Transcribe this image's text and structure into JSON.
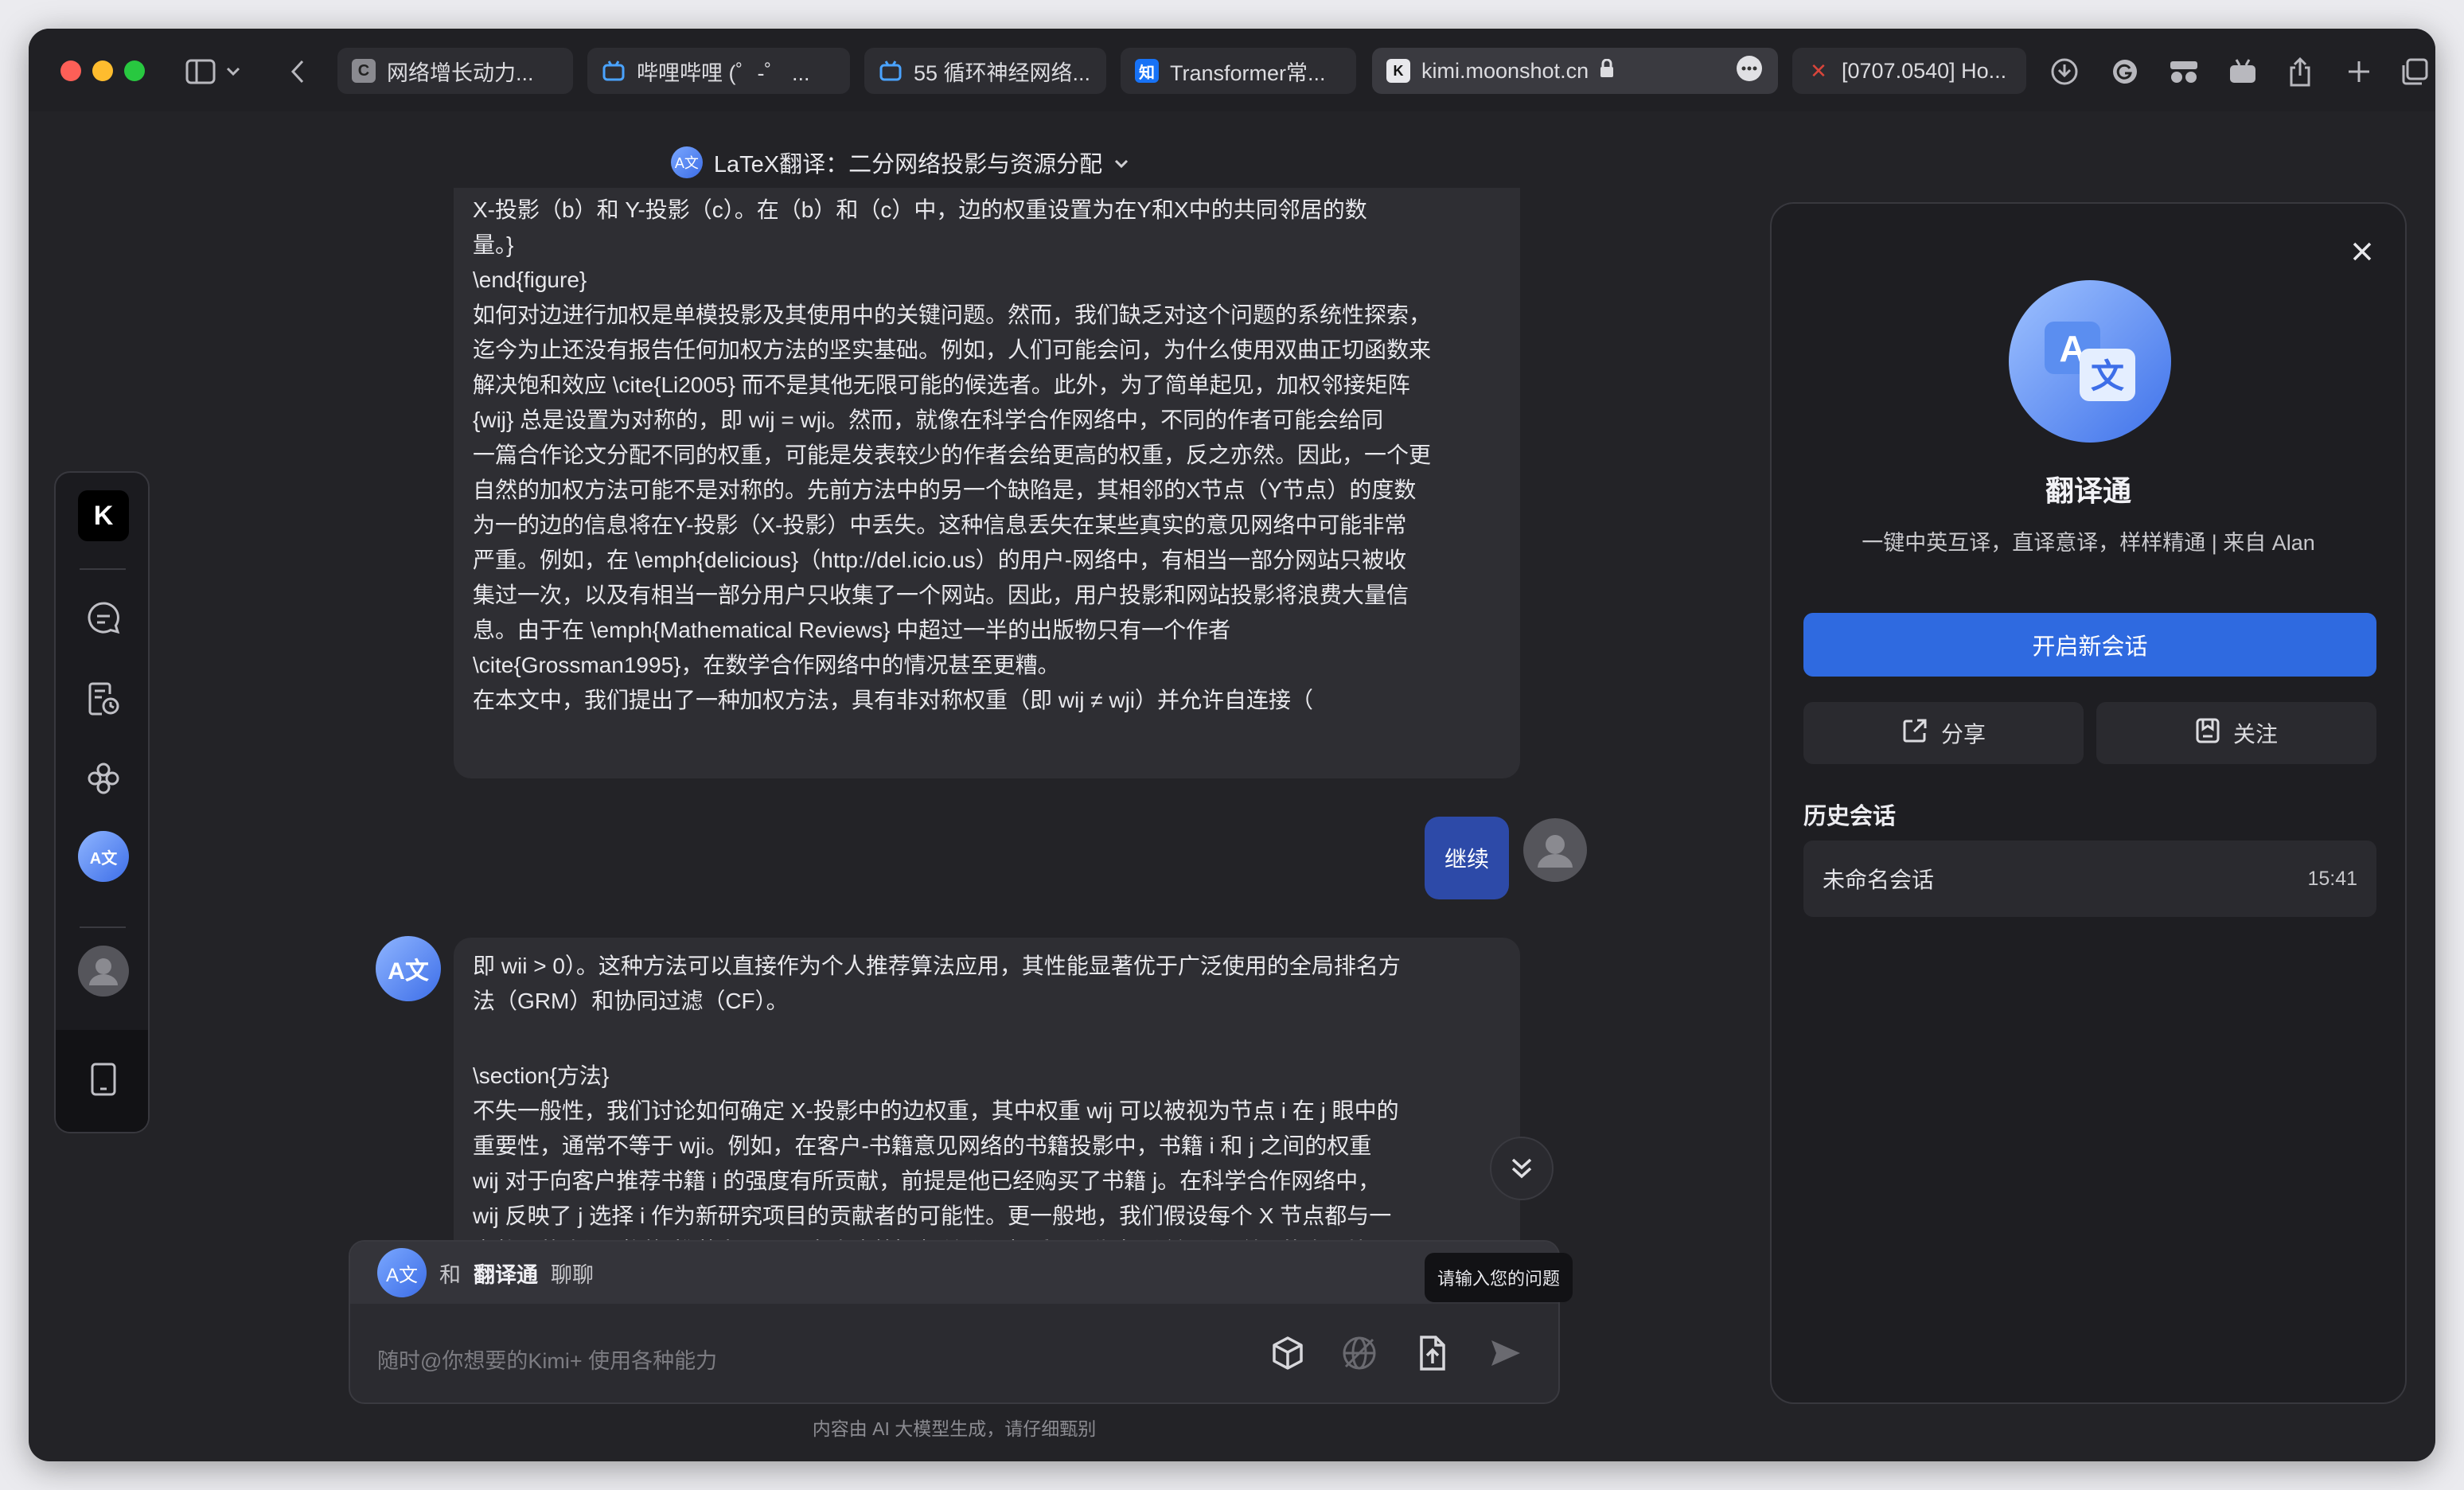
{
  "tabs": [
    {
      "favicon": "C",
      "label": "网络增长动力..."
    },
    {
      "favicon": "bilibili",
      "label": "哔哩哔哩 (゜-゜ ..."
    },
    {
      "favicon": "bilibili",
      "label": "55 循环神经网络..."
    },
    {
      "favicon": "知",
      "label": "Transformer常..."
    },
    {
      "favicon": "K",
      "label": "kimi.moonshot.cn"
    },
    {
      "favicon": "arxiv",
      "label": "[0707.0540] Ho..."
    }
  ],
  "header": {
    "title": "LaTeX翻译：二分网络投影与资源分配"
  },
  "messages": {
    "bot1": [
      "X-投影（b）和 Y-投影（c）。在（b）和（c）中，边的权重设置为在Y和X中的共同邻居的数",
      "量。}",
      "\\end{figure}",
      "如何对边进行加权是单模投影及其使用中的关键问题。然而，我们缺乏对这个问题的系统性探索，",
      "迄今为止还没有报告任何加权方法的坚实基础。例如，人们可能会问，为什么使用双曲正切函数来",
      "解决饱和效应 \\cite{Li2005} 而不是其他无限可能的候选者。此外，为了简单起见，加权邻接矩阵",
      "{wij} 总是设置为对称的，即 wij = wji。然而，就像在科学合作网络中，不同的作者可能会给同",
      "一篇合作论文分配不同的权重，可能是发表较少的作者会给更高的权重，反之亦然。因此，一个更",
      "自然的加权方法可能不是对称的。先前方法中的另一个缺陷是，其相邻的X节点（Y节点）的度数",
      "为一的边的信息将在Y-投影（X-投影）中丢失。这种信息丢失在某些真实的意见网络中可能非常",
      "严重。例如，在 \\emph{delicious}（http://del.icio.us）的用户-网络中，有相当一部分网站只被收",
      "集过一次，以及有相当一部分用户只收集了一个网站。因此，用户投影和网站投影将浪费大量信",
      "息。由于在 \\emph{Mathematical Reviews} 中超过一半的出版物只有一个作者",
      "\\cite{Grossman1995}，在数学合作网络中的情况甚至更糟。",
      "在本文中，我们提出了一种加权方法，具有非对称权重（即 wij ≠ wji）并允许自连接（"
    ],
    "user": "继续",
    "bot2": [
      "即 wii > 0）。这种方法可以直接作为个人推荐算法应用，其性能显著优于广泛使用的全局排名方",
      "法（GRM）和协同过滤（CF）。",
      "",
      "\\section{方法}",
      "不失一般性，我们讨论如何确定 X-投影中的边权重，其中权重 wij 可以被视为节点 i 在 j 眼中的",
      "重要性，通常不等于 wji。例如，在客户-书籍意见网络的书籍投影中，书籍 i 和 j 之间的权重",
      "wij 对于向客户推荐书籍 i 的强度有所贡献，前提是他已经购买了书籍 j。在科学合作网络中，",
      "wij 反映了 j 选择 i 作为新研究项目的贡献者的可能性。更一般地，我们假设每个 X 节点都与一",
      "定数量的资源（例如推荐力量、研究资金等）相关联，权重 wij 代表 j 希望分配给 i 的资源比"
    ]
  },
  "composer": {
    "prefix": "和",
    "bot_name": "翻译通",
    "suffix": "聊聊",
    "placeholder": "随时@你想要的Kimi+ 使用各种能力",
    "tooltip": "请输入您的问题"
  },
  "disclaimer": "内容由 AI 大模型生成，请仔细甄别",
  "panel": {
    "name": "翻译通",
    "description": "一键中英互译，直译意译，样样精通 | 来自 Alan",
    "new_chat": "开启新会话",
    "share": "分享",
    "follow": "关注",
    "history_title": "历史会话",
    "history": [
      {
        "title": "未命名会话",
        "time": "15:41"
      }
    ]
  },
  "colors": {
    "accent": "#2f6ae0",
    "user_bubble": "#2d4aa8",
    "background": "#232327"
  }
}
